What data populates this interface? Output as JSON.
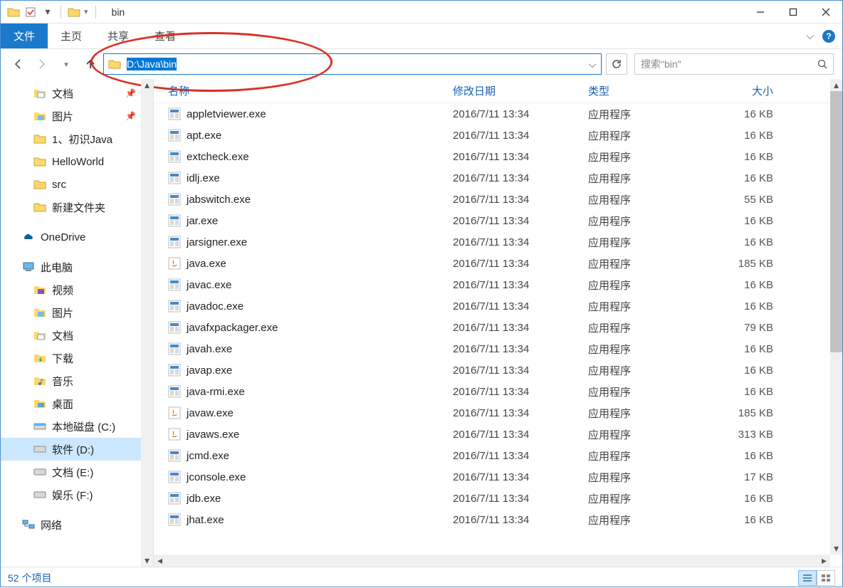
{
  "window": {
    "title": "bin",
    "minimize": "−",
    "maximize": "□",
    "close": "✕"
  },
  "ribbon": {
    "file": "文件",
    "home": "主页",
    "share": "共享",
    "view": "查看"
  },
  "nav": {
    "address": "D:\\Java\\bin",
    "search_placeholder": "搜索\"bin\""
  },
  "sidebar": {
    "quick_items": [
      {
        "icon": "docs",
        "label": "文档",
        "pinned": true
      },
      {
        "icon": "pics",
        "label": "图片",
        "pinned": true
      },
      {
        "icon": "folder",
        "label": "1、初识Java",
        "pinned": false
      },
      {
        "icon": "folder",
        "label": "HelloWorld",
        "pinned": false
      },
      {
        "icon": "folder",
        "label": "src",
        "pinned": false
      },
      {
        "icon": "folder",
        "label": "新建文件夹",
        "pinned": false
      }
    ],
    "onedrive": "OneDrive",
    "thispc": "此电脑",
    "pc_items": [
      {
        "icon": "video",
        "label": "视频"
      },
      {
        "icon": "pics",
        "label": "图片"
      },
      {
        "icon": "docs",
        "label": "文档"
      },
      {
        "icon": "dl",
        "label": "下载"
      },
      {
        "icon": "music",
        "label": "音乐"
      },
      {
        "icon": "desktop",
        "label": "桌面"
      },
      {
        "icon": "drive-c",
        "label": "本地磁盘 (C:)"
      },
      {
        "icon": "drive-d",
        "label": "软件 (D:)",
        "selected": true
      },
      {
        "icon": "drive",
        "label": "文档 (E:)"
      },
      {
        "icon": "drive",
        "label": "娱乐 (F:)"
      }
    ],
    "network": "网络"
  },
  "columns": {
    "name": "名称",
    "date": "修改日期",
    "type": "类型",
    "size": "大小"
  },
  "files": [
    {
      "name": "appletviewer.exe",
      "date": "2016/7/11 13:34",
      "type": "应用程序",
      "size": "16 KB",
      "icon": "exe"
    },
    {
      "name": "apt.exe",
      "date": "2016/7/11 13:34",
      "type": "应用程序",
      "size": "16 KB",
      "icon": "exe"
    },
    {
      "name": "extcheck.exe",
      "date": "2016/7/11 13:34",
      "type": "应用程序",
      "size": "16 KB",
      "icon": "exe"
    },
    {
      "name": "idlj.exe",
      "date": "2016/7/11 13:34",
      "type": "应用程序",
      "size": "16 KB",
      "icon": "exe"
    },
    {
      "name": "jabswitch.exe",
      "date": "2016/7/11 13:34",
      "type": "应用程序",
      "size": "55 KB",
      "icon": "exe"
    },
    {
      "name": "jar.exe",
      "date": "2016/7/11 13:34",
      "type": "应用程序",
      "size": "16 KB",
      "icon": "exe"
    },
    {
      "name": "jarsigner.exe",
      "date": "2016/7/11 13:34",
      "type": "应用程序",
      "size": "16 KB",
      "icon": "exe"
    },
    {
      "name": "java.exe",
      "date": "2016/7/11 13:34",
      "type": "应用程序",
      "size": "185 KB",
      "icon": "java"
    },
    {
      "name": "javac.exe",
      "date": "2016/7/11 13:34",
      "type": "应用程序",
      "size": "16 KB",
      "icon": "exe"
    },
    {
      "name": "javadoc.exe",
      "date": "2016/7/11 13:34",
      "type": "应用程序",
      "size": "16 KB",
      "icon": "exe"
    },
    {
      "name": "javafxpackager.exe",
      "date": "2016/7/11 13:34",
      "type": "应用程序",
      "size": "79 KB",
      "icon": "exe"
    },
    {
      "name": "javah.exe",
      "date": "2016/7/11 13:34",
      "type": "应用程序",
      "size": "16 KB",
      "icon": "exe"
    },
    {
      "name": "javap.exe",
      "date": "2016/7/11 13:34",
      "type": "应用程序",
      "size": "16 KB",
      "icon": "exe"
    },
    {
      "name": "java-rmi.exe",
      "date": "2016/7/11 13:34",
      "type": "应用程序",
      "size": "16 KB",
      "icon": "exe"
    },
    {
      "name": "javaw.exe",
      "date": "2016/7/11 13:34",
      "type": "应用程序",
      "size": "185 KB",
      "icon": "java"
    },
    {
      "name": "javaws.exe",
      "date": "2016/7/11 13:34",
      "type": "应用程序",
      "size": "313 KB",
      "icon": "java"
    },
    {
      "name": "jcmd.exe",
      "date": "2016/7/11 13:34",
      "type": "应用程序",
      "size": "16 KB",
      "icon": "exe"
    },
    {
      "name": "jconsole.exe",
      "date": "2016/7/11 13:34",
      "type": "应用程序",
      "size": "17 KB",
      "icon": "exe"
    },
    {
      "name": "jdb.exe",
      "date": "2016/7/11 13:34",
      "type": "应用程序",
      "size": "16 KB",
      "icon": "exe"
    },
    {
      "name": "jhat.exe",
      "date": "2016/7/11 13:34",
      "type": "应用程序",
      "size": "16 KB",
      "icon": "exe"
    }
  ],
  "status": {
    "count": "52 个项目"
  }
}
